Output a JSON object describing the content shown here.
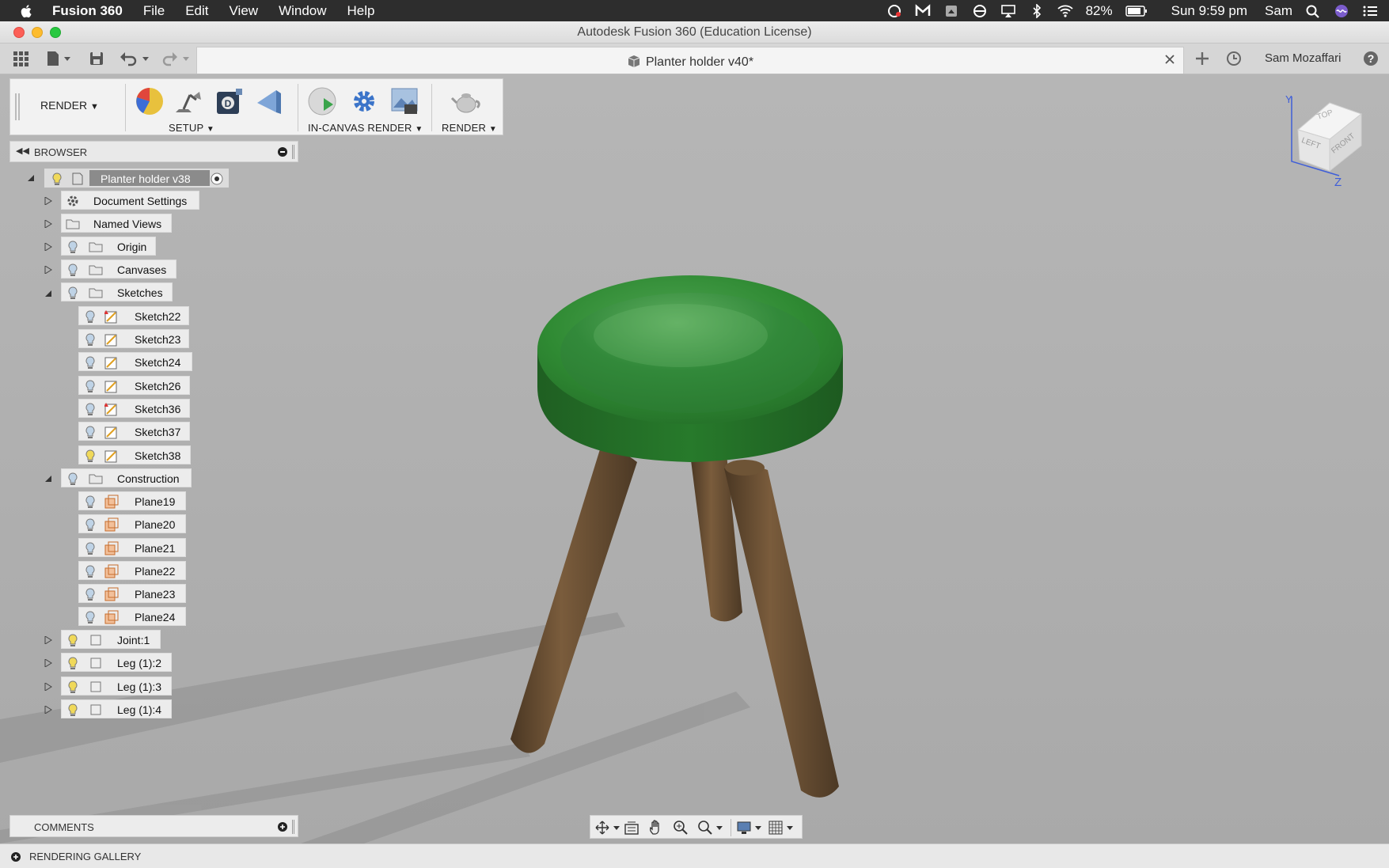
{
  "menubar": {
    "app_name": "Fusion 360",
    "menus": [
      "File",
      "Edit",
      "View",
      "Window",
      "Help"
    ],
    "battery": "82%",
    "clock": "Sun 9:59 pm",
    "user": "Sam"
  },
  "window": {
    "title": "Autodesk Fusion 360 (Education License)"
  },
  "tabbar": {
    "doc_tab": "Planter holder v40*",
    "user": "Sam Mozaffari"
  },
  "toolbar": {
    "workspace": "RENDER",
    "groups": [
      "SETUP",
      "IN-CANVAS RENDER",
      "RENDER"
    ]
  },
  "browser": {
    "header": "BROWSER",
    "root": "Planter holder v38",
    "items": {
      "document_settings": "Document Settings",
      "named_views": "Named Views",
      "origin": "Origin",
      "canvases": "Canvases",
      "sketches": "Sketches",
      "construction": "Construction",
      "joint": "Joint:1",
      "leg2": "Leg (1):2",
      "leg3": "Leg (1):3",
      "leg4": "Leg (1):4"
    },
    "sketches": [
      "Sketch22",
      "Sketch23",
      "Sketch24",
      "Sketch26",
      "Sketch36",
      "Sketch37",
      "Sketch38"
    ],
    "planes": [
      "Plane19",
      "Plane20",
      "Plane21",
      "Plane22",
      "Plane23",
      "Plane24"
    ]
  },
  "viewcube": {
    "top": "TOP",
    "left": "LEFT",
    "front": "FRONT",
    "axis_y": "Y",
    "axis_z": "Z"
  },
  "comments": {
    "label": "COMMENTS"
  },
  "gallery": {
    "label": "RENDERING GALLERY"
  },
  "colors": {
    "seat_green": "#2f8a33",
    "leg_brown": "#6b5134",
    "background": "#b4b4b4"
  }
}
